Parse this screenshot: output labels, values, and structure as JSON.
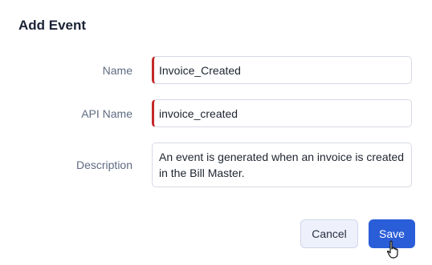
{
  "dialog": {
    "title": "Add Event",
    "fields": {
      "name": {
        "label": "Name",
        "value": "Invoice_Created"
      },
      "api_name": {
        "label": "API Name",
        "value": "invoice_created"
      },
      "description": {
        "label": "Description",
        "value": "An event is generated when an invoice is created in the Bill Master."
      }
    },
    "buttons": {
      "cancel": "Cancel",
      "save": "Save"
    }
  },
  "colors": {
    "primary": "#2a5dd8",
    "required_marker": "#c62828"
  },
  "cursor": "hand-pointer-icon"
}
